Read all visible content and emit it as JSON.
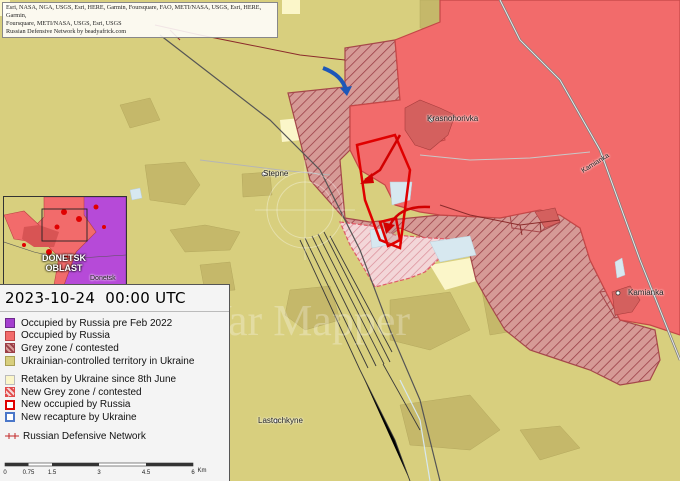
{
  "attribution": [
    "Esri, NASA, NGA, USGS, Esri, HERE, Garmin, Foursquare, FAO, METI/NASA, USGS, Esri, HERE, Garmin,",
    "Foursquare, METI/NASA, USGS, Esri, USGS",
    "Russian Defensive Network by beadyafrick.com"
  ],
  "places": {
    "krasnohorivka": "Krasnohorivka",
    "stepne": "Stepne",
    "kamianka_road": "Kamianka",
    "kamianka": "Kamianka",
    "lastochkyne": "Lastochkyne"
  },
  "inset": {
    "oblast": "DONETSK OBLAST",
    "city": "Donetsk"
  },
  "timestamp": "2023-10-24  00:00 UTC",
  "watermark": "War Mapper",
  "legend": [
    {
      "label": "Occupied by Russia pre Feb 2022",
      "color": "#a43fcf",
      "style": "solid"
    },
    {
      "label": "Occupied by Russia",
      "color": "#f26b6b",
      "style": "solid"
    },
    {
      "label": "Grey zone / contested",
      "color": "#c98383",
      "style": "hatch"
    },
    {
      "label": "Ukrainian-controlled territory in Ukraine",
      "color": "#d8cf7e",
      "style": "solid"
    },
    {
      "label": "Retaken by Ukraine since 8th June",
      "color": "#fbf6c9",
      "style": "solid"
    },
    {
      "label": "New Grey zone / contested",
      "color": "#e14a4a",
      "style": "newgrey"
    },
    {
      "label": "New occupied by Russia",
      "color": "#e00000",
      "style": "newocc"
    },
    {
      "label": "New recapture by Ukraine",
      "color": "#4a77c9",
      "style": "newrecap"
    },
    {
      "label": "Russian Defensive Network",
      "color": "#c22828",
      "style": "line"
    }
  ],
  "scale": {
    "ticks": [
      "0",
      "0.75",
      "1.5",
      "3",
      "4.5",
      "6"
    ],
    "unit": "Km"
  }
}
